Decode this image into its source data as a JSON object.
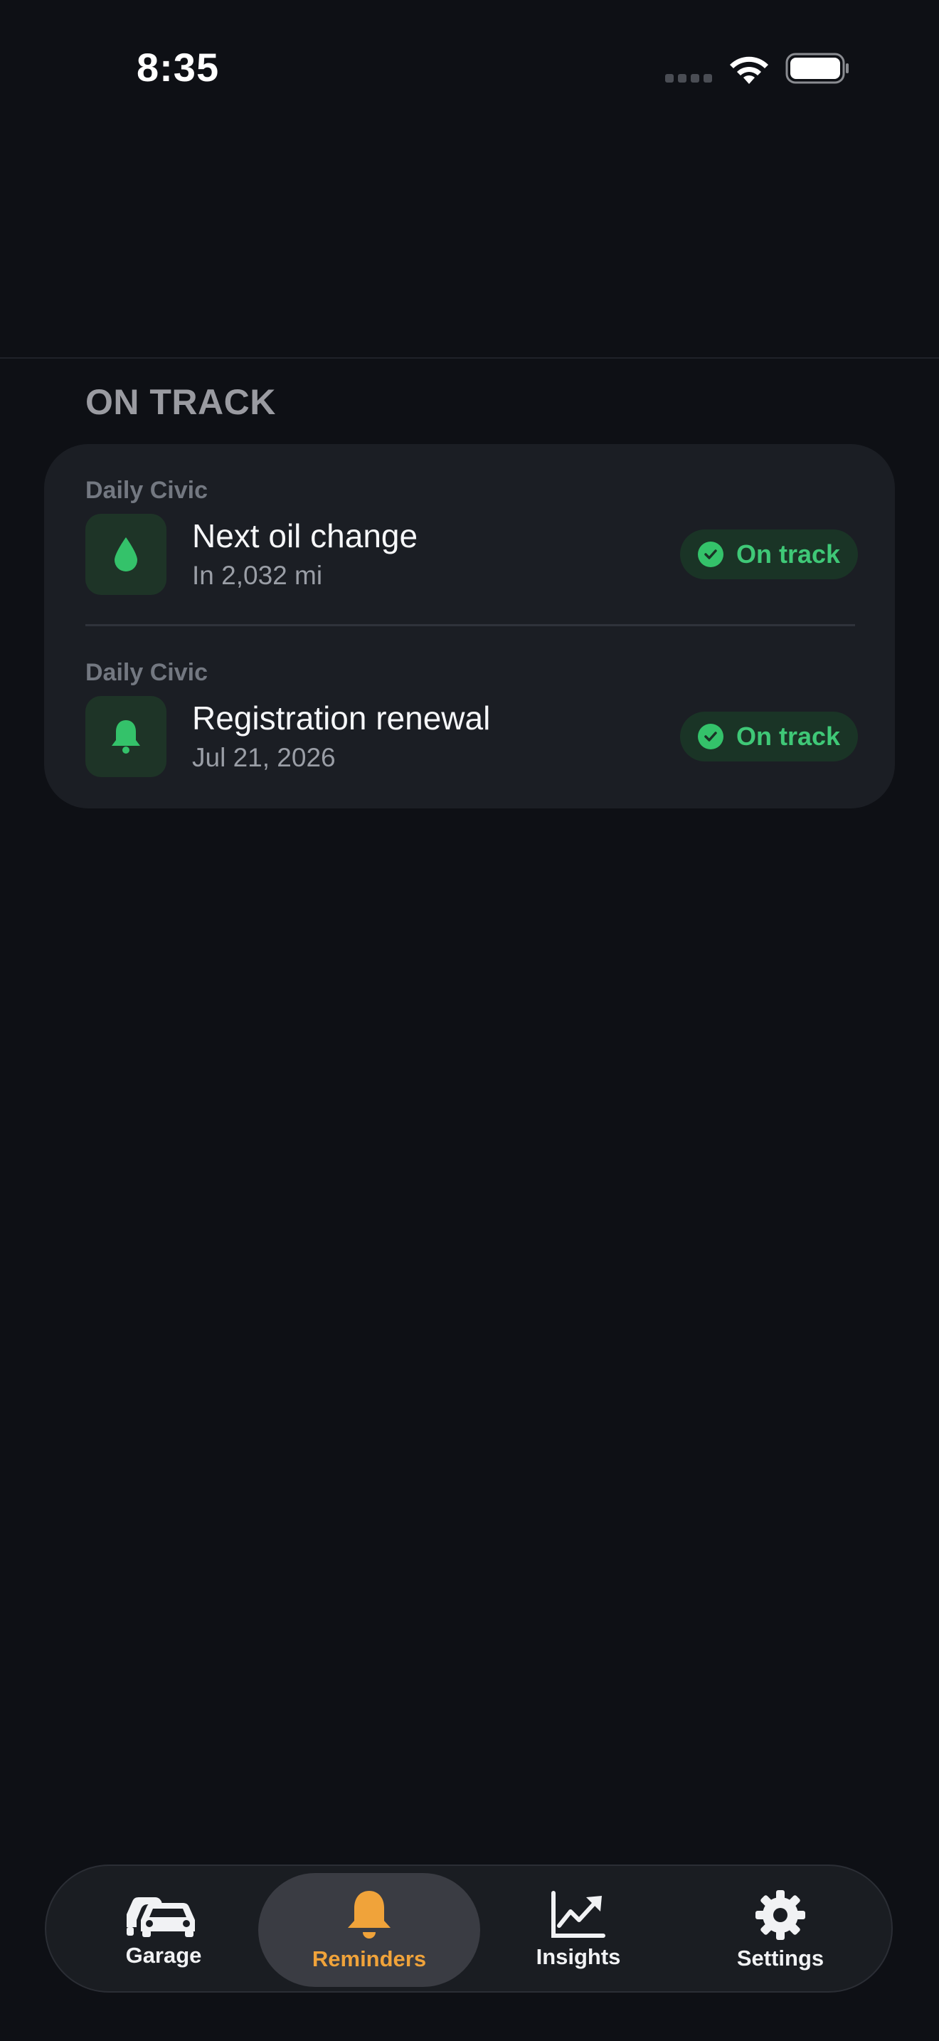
{
  "status_bar": {
    "time": "8:35"
  },
  "section": {
    "title": "ON TRACK"
  },
  "reminders": [
    {
      "vehicle": "Daily Civic",
      "title": "Next oil change",
      "subtitle": "In 2,032 mi",
      "icon": "drop-icon",
      "status": "On track"
    },
    {
      "vehicle": "Daily Civic",
      "title": "Registration renewal",
      "subtitle": "Jul 21, 2026",
      "icon": "bell-icon",
      "status": "On track"
    }
  ],
  "tabbar": {
    "tabs": [
      {
        "label": "Garage",
        "icon": "cars-icon",
        "active": false
      },
      {
        "label": "Reminders",
        "icon": "bell-icon",
        "active": true
      },
      {
        "label": "Insights",
        "icon": "chart-icon",
        "active": false
      },
      {
        "label": "Settings",
        "icon": "gear-icon",
        "active": false
      }
    ]
  },
  "colors": {
    "background": "#0e1015",
    "card": "#1b1e24",
    "status_green": "#3fc877",
    "accent_orange": "#f0a33a"
  }
}
